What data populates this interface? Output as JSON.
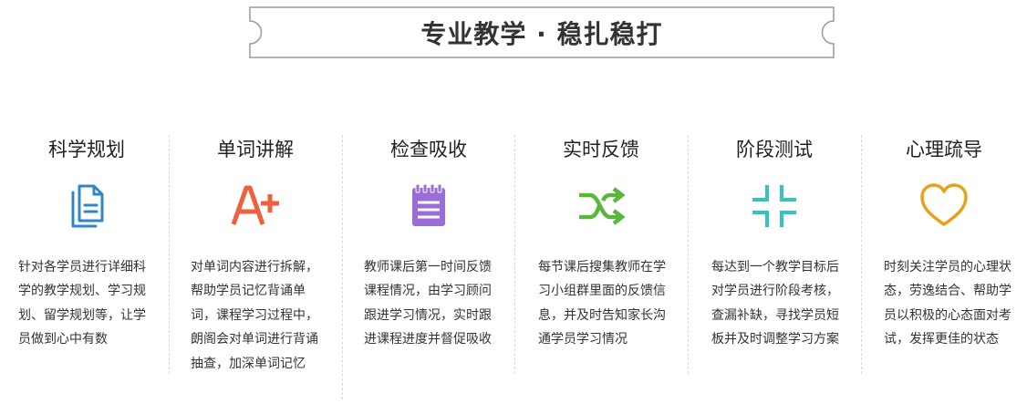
{
  "banner": {
    "title": "专业教学 · 稳扎稳打"
  },
  "features": [
    {
      "title": "科学规划",
      "icon": "document-icon",
      "color": "#2f86c8",
      "description": "针对各学员进行详细科学的教学规划、学习规划、留学规划等，让学员做到心中有数"
    },
    {
      "title": "单词讲解",
      "icon": "a-plus-icon",
      "color": "#f0603e",
      "description": "对单词内容进行拆解，帮助学员记忆背诵单词，课程学习过程中，朗阁会对单词进行背诵抽查，加深单词记忆"
    },
    {
      "title": "检查吸收",
      "icon": "notepad-icon",
      "color": "#9b6bd6",
      "description": "教师课后第一时间反馈课程情况，由学习顾问跟进学习情况，实时跟进课程进度并督促吸收"
    },
    {
      "title": "实时反馈",
      "icon": "shuffle-icon",
      "color": "#5ab63c",
      "description": "每节课后搜集教师在学习小组群里面的反馈信息，并及时告知家长沟通学员学习情况"
    },
    {
      "title": "阶段测试",
      "icon": "collapse-icon",
      "color": "#33c4c0",
      "description": "每达到一个教学目标后对学员进行阶段考核，查漏补缺，寻找学员短板并及时调整学习方案"
    },
    {
      "title": "心理疏导",
      "icon": "heart-icon",
      "color": "#e8a11c",
      "description": "时刻关注学员的心理状态，劳逸结合、帮助学员以积极的心态面对考试，发挥更佳的状态"
    }
  ]
}
